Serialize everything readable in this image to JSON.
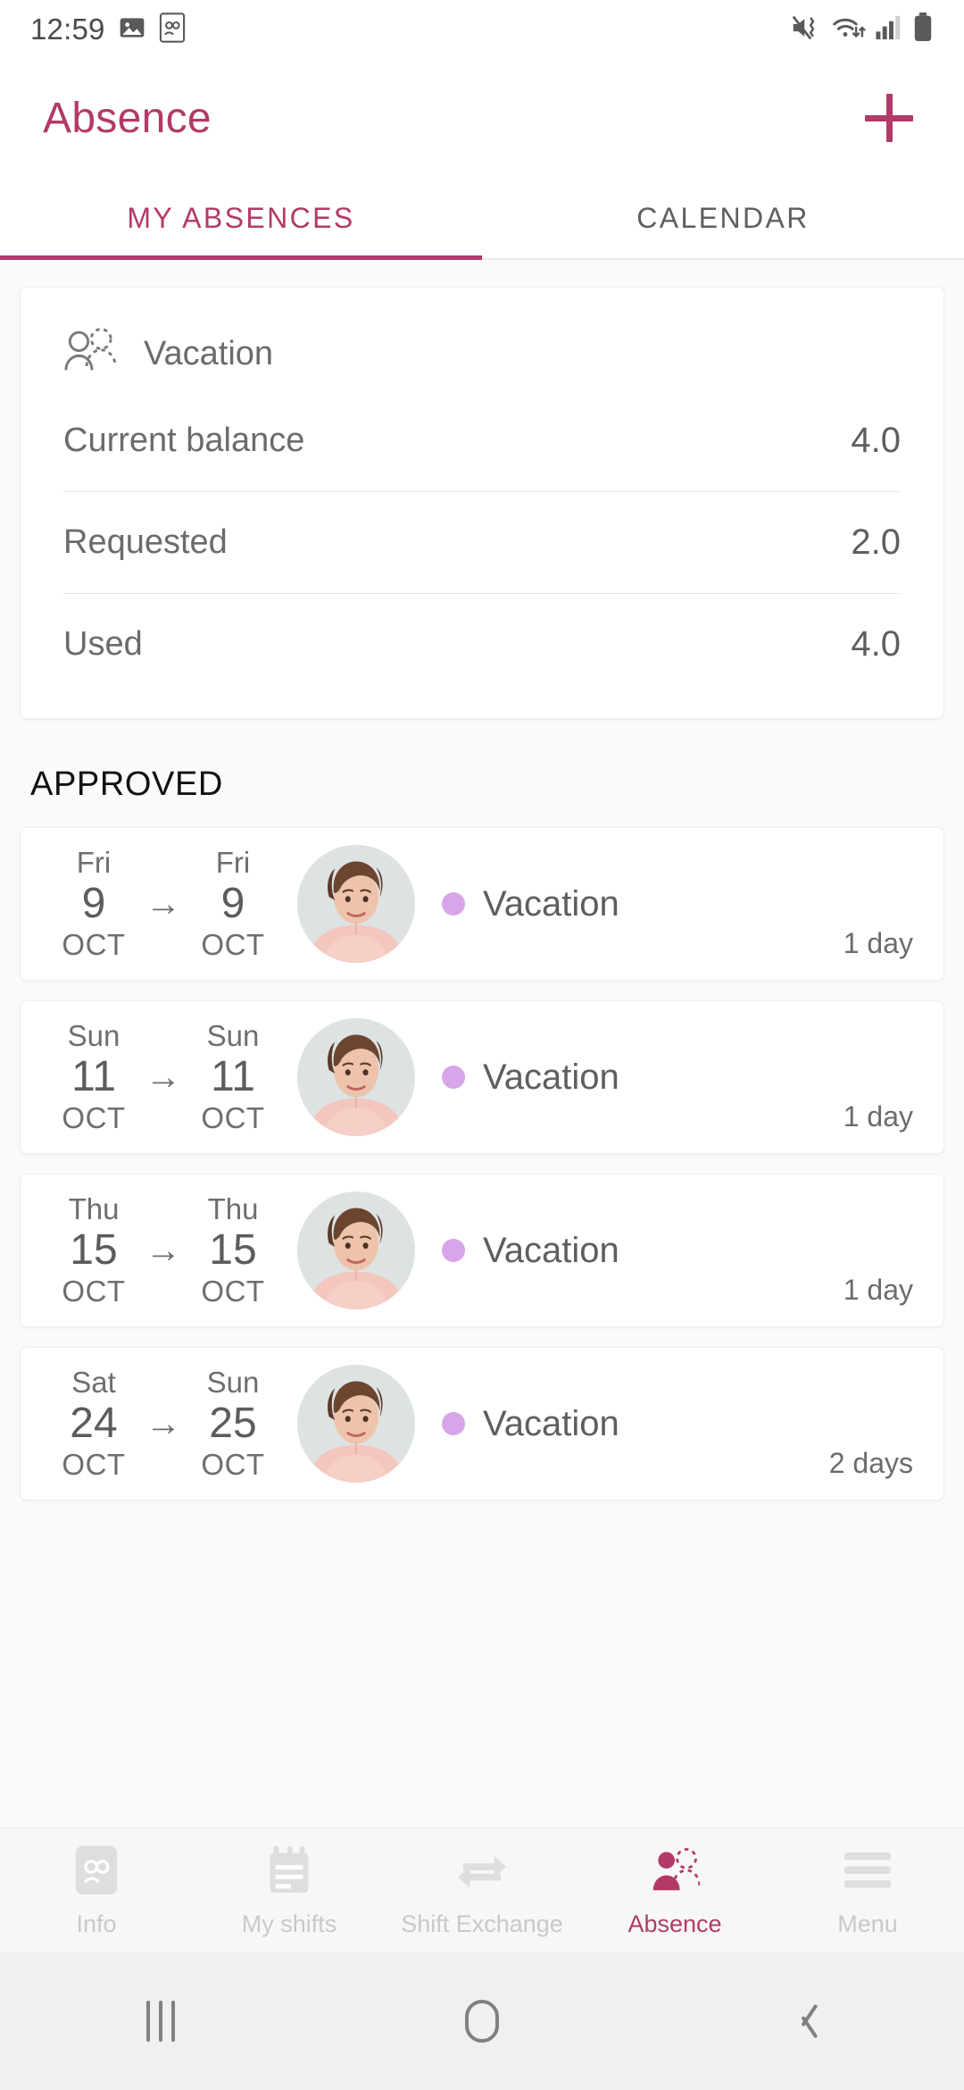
{
  "status_bar": {
    "time": "12:59",
    "left_icons": [
      "image-icon",
      "contacts-icon"
    ],
    "right_icons": [
      "mute-vibrate-icon",
      "wifi-icon",
      "signal-icon",
      "battery-icon"
    ]
  },
  "app_bar": {
    "title": "Absence",
    "add_label": "+",
    "accent_color": "#B23A68"
  },
  "tabs": [
    {
      "label": "MY ABSENCES",
      "active": true
    },
    {
      "label": "CALENDAR",
      "active": false
    }
  ],
  "balance_card": {
    "icon": "vacation-person-icon",
    "title": "Vacation",
    "rows": [
      {
        "label": "Current balance",
        "value": "4.0"
      },
      {
        "label": "Requested",
        "value": "2.0"
      },
      {
        "label": "Used",
        "value": "4.0"
      }
    ]
  },
  "section": {
    "approved_title": "APPROVED"
  },
  "absences": [
    {
      "start_dow": "Fri",
      "start_day": "9",
      "start_mon": "OCT",
      "arrow": "→",
      "end_dow": "Fri",
      "end_day": "9",
      "end_mon": "OCT",
      "type": "Vacation",
      "type_color": "#D6A6E8",
      "duration": "1 day",
      "avatar": "employee-photo"
    },
    {
      "start_dow": "Sun",
      "start_day": "11",
      "start_mon": "OCT",
      "arrow": "→",
      "end_dow": "Sun",
      "end_day": "11",
      "end_mon": "OCT",
      "type": "Vacation",
      "type_color": "#D6A6E8",
      "duration": "1 day",
      "avatar": "employee-photo"
    },
    {
      "start_dow": "Thu",
      "start_day": "15",
      "start_mon": "OCT",
      "arrow": "→",
      "end_dow": "Thu",
      "end_day": "15",
      "end_mon": "OCT",
      "type": "Vacation",
      "type_color": "#D6A6E8",
      "duration": "1 day",
      "avatar": "employee-photo"
    },
    {
      "start_dow": "Sat",
      "start_day": "24",
      "start_mon": "OCT",
      "arrow": "→",
      "end_dow": "Sun",
      "end_day": "25",
      "end_mon": "OCT",
      "type": "Vacation",
      "type_color": "#D6A6E8",
      "duration": "2 days",
      "avatar": "employee-photo"
    }
  ],
  "bottom_nav": [
    {
      "label": "Info",
      "icon": "contact-card-icon",
      "active": false
    },
    {
      "label": "My shifts",
      "icon": "shift-list-icon",
      "active": false
    },
    {
      "label": "Shift Exchange",
      "icon": "swap-arrows-icon",
      "active": false
    },
    {
      "label": "Absence",
      "icon": "absence-person-icon",
      "active": true
    },
    {
      "label": "Menu",
      "icon": "hamburger-icon",
      "active": false
    }
  ],
  "system_nav": {
    "recents": "recents-icon",
    "home": "home-icon",
    "back": "back-icon"
  }
}
